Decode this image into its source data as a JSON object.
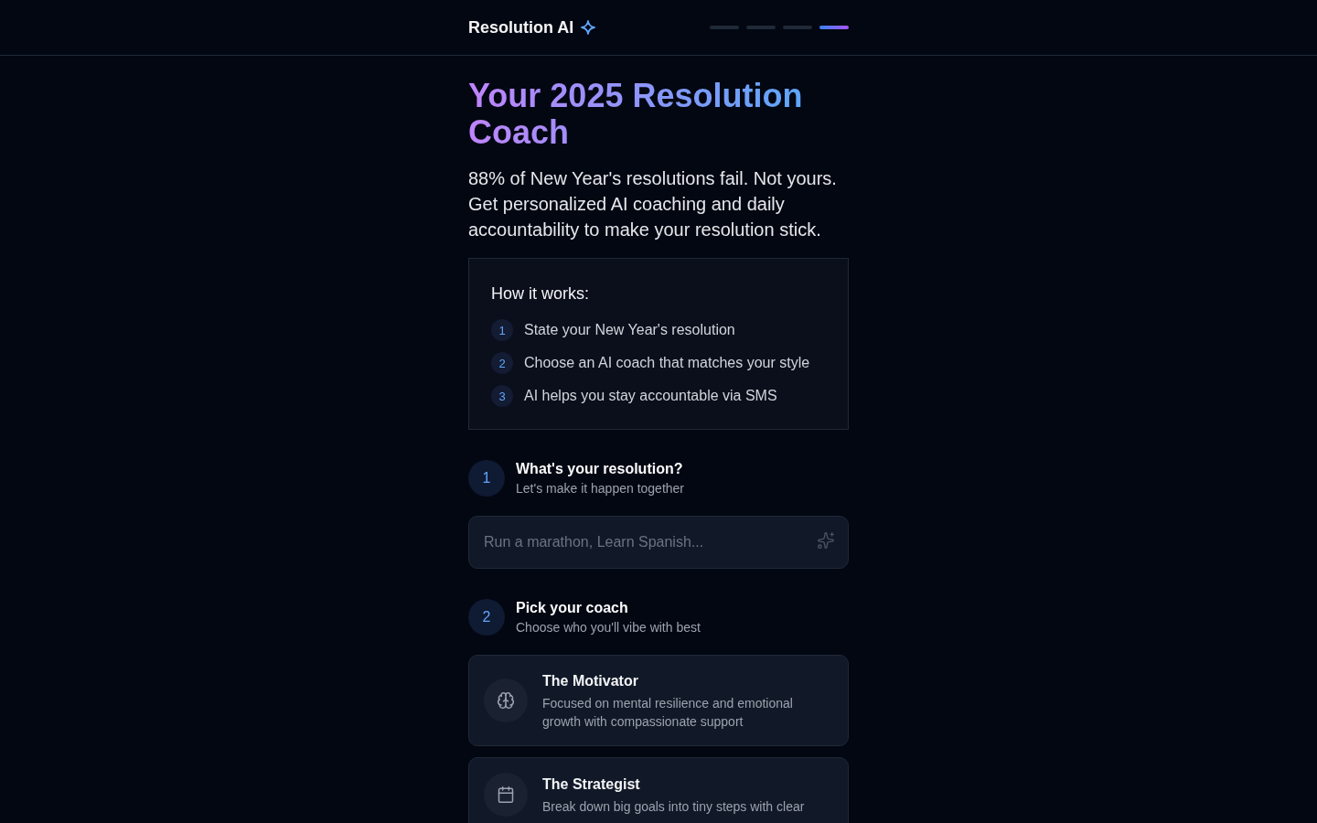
{
  "header": {
    "logo": "Resolution AI",
    "progress": [
      {
        "active": false
      },
      {
        "active": false
      },
      {
        "active": false
      },
      {
        "active": true
      }
    ]
  },
  "hero": {
    "title": "Your 2025 Resolution Coach",
    "subtitle": "88% of New Year's resolutions fail. Not yours. Get personalized AI coaching and daily accountability to make your resolution stick."
  },
  "how_it_works": {
    "title": "How it works:",
    "items": [
      {
        "number": "1",
        "text": "State your New Year's resolution"
      },
      {
        "number": "2",
        "text": "Choose an AI coach that matches your style"
      },
      {
        "number": "3",
        "text": "AI helps you stay accountable via SMS"
      }
    ]
  },
  "steps": [
    {
      "kind": "input",
      "number": "1",
      "title": "What's your resolution?",
      "subtitle": "Let's make it happen together",
      "input": {
        "placeholder": "Run a marathon, Learn Spanish..."
      }
    },
    {
      "kind": "coaches",
      "number": "2",
      "title": "Pick your coach",
      "subtitle": "Choose who you'll vibe with best",
      "coaches": [
        {
          "name": "The Motivator",
          "description": "Focused on mental resilience and emotional growth with compassionate support",
          "selected": false
        },
        {
          "name": "The Strategist",
          "description": "Break down big goals into tiny steps with clear",
          "selected": false
        }
      ]
    }
  ]
}
